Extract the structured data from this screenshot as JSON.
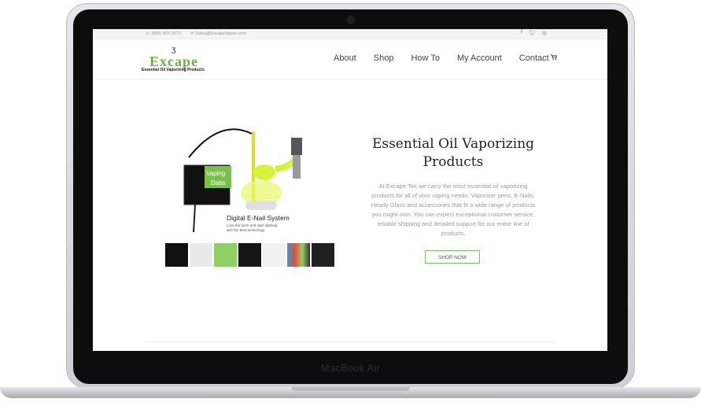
{
  "device": {
    "label": "MacBook Air"
  },
  "topbar": {
    "phone": "(888) 407-2679",
    "email": "Sales@ExcapeVapes.com",
    "social_icons": [
      "facebook-icon",
      "twitter-icon",
      "instagram-icon"
    ]
  },
  "logo": {
    "name": "Excape",
    "tagline": "Essential Oil Vaporizing Products"
  },
  "nav": {
    "items": [
      "About",
      "Shop",
      "How To",
      "My Account",
      "Contact"
    ],
    "cart_icon": "cart-icon"
  },
  "hero": {
    "image_badge_lines": [
      "Vaping",
      "Dabs"
    ],
    "image_caption": "Digital E-Nail System",
    "image_subcaption_1": "Lose the torch and start dabbing",
    "image_subcaption_2": "with the best technology.",
    "title_line1": "Essential Oil Vaporizing",
    "title_line2": "Products",
    "description": "At Excape Tek we carry the most essential oil vaporizing products for all of your vaping needs. Vaporizer pens, E-Nails, Heady Glass and accessories that fit a wide range of products you might own. You can expect exceptional customer service, reliable shipping and detailed support for our entire line of products.",
    "button_label": "SHOP NOW"
  },
  "colors": {
    "accent": "#62b536",
    "button_border": "#7cc45a",
    "text_muted": "#9c9c9c"
  }
}
